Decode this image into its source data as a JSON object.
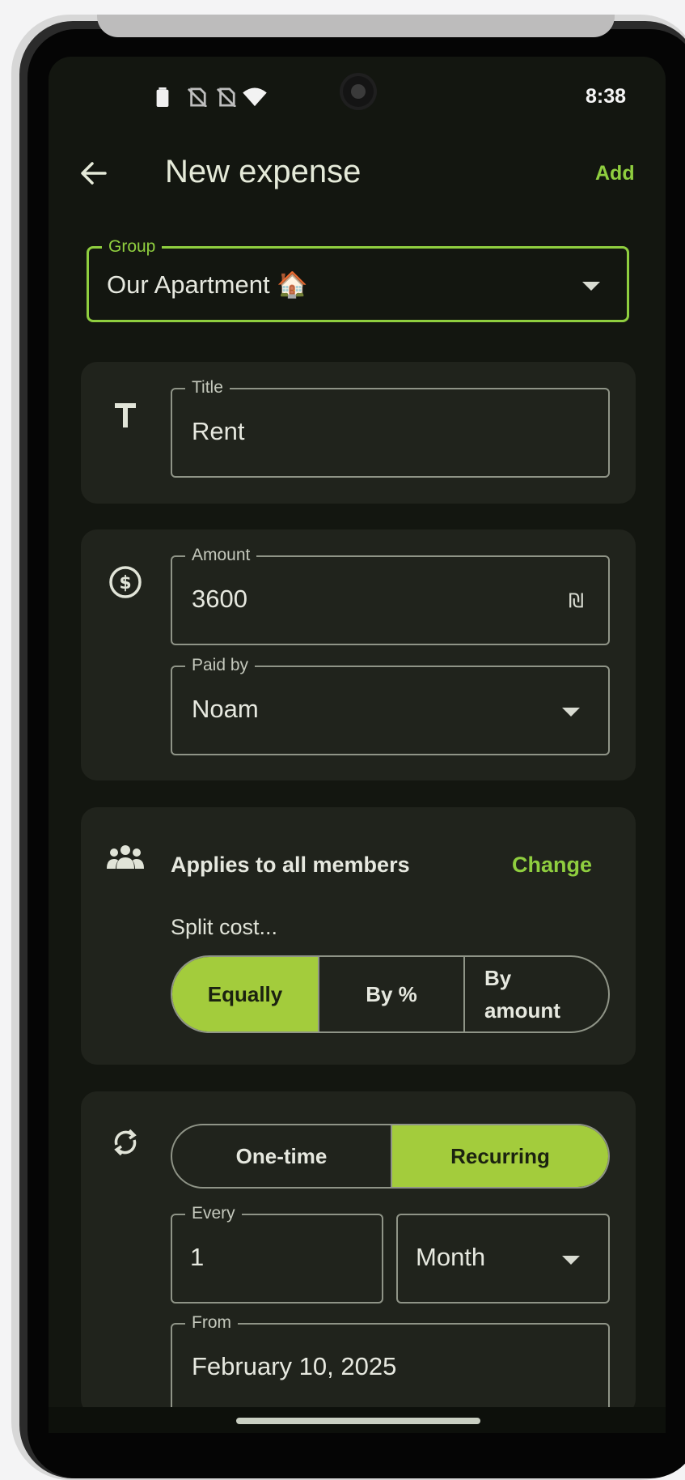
{
  "status": {
    "time": "8:38"
  },
  "appbar": {
    "title": "New expense",
    "action": "Add"
  },
  "group": {
    "label": "Group",
    "value": "Our Apartment 🏠"
  },
  "title_field": {
    "label": "Title",
    "value": "Rent"
  },
  "amount_field": {
    "label": "Amount",
    "value": "3600",
    "currency": "₪"
  },
  "paid_by": {
    "label": "Paid by",
    "value": "Noam"
  },
  "members": {
    "text": "Applies to all members",
    "change": "Change",
    "split_label": "Split cost...",
    "options": [
      "Equally",
      "By %",
      "By\namount"
    ],
    "selected": "Equally"
  },
  "recurrence": {
    "options": [
      "One-time",
      "Recurring"
    ],
    "selected": "Recurring",
    "every_label": "Every",
    "every_value": "1",
    "unit": "Month",
    "from_label": "From",
    "from_value": "February 10, 2025"
  },
  "icons": {
    "back": "arrow-left-icon",
    "title": "text-t-icon",
    "amount": "dollar-circle-icon",
    "members": "group-icon",
    "recurrence": "repeat-icon"
  },
  "colors": {
    "accent": "#8fce3f",
    "selected": "#a3cc3c",
    "background": "#131610",
    "card": "#20231c"
  }
}
